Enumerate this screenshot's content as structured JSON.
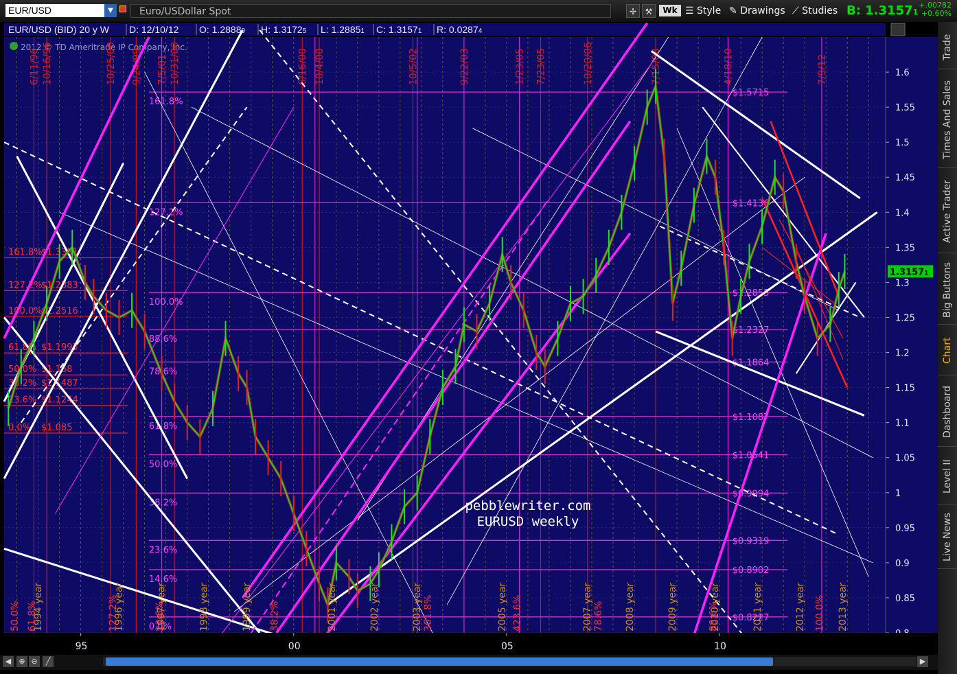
{
  "toolbar": {
    "symbol": "EUR/USD",
    "description": "Euro/USDollar Spot",
    "period_button": "Wk",
    "style_label": "Style",
    "drawings_label": "Drawings",
    "studies_label": "Studies",
    "bid_label": "B: 1.3157",
    "bid_suffix": "1",
    "change_abs": "+.00782",
    "change_pct": "+0.60%"
  },
  "sidebar": {
    "tabs": [
      "Trade",
      "Times And Sales",
      "Active Trader",
      "Big Buttons",
      "Chart",
      "Dashboard",
      "Level II",
      "Live News"
    ],
    "active": "Chart"
  },
  "chart_data": {
    "type": "line",
    "header": {
      "instrument": "EUR/USD (BID) 20 y W",
      "date": "D: 12/10/12",
      "open": "O: 1.2888",
      "open_s": "9",
      "high": "H: 1.3172",
      "high_s": "5",
      "low": "L: 1.2885",
      "low_s": "1",
      "close": "C: 1.3157",
      "close_s": "1",
      "range": "R: 0.0287",
      "range_s": "4",
      "copyright": "2012 © TD Ameritrade IP Company, Inc."
    },
    "ylim": [
      0.8,
      1.65
    ],
    "y_ticks": [
      0.8,
      0.85,
      0.9,
      0.95,
      1,
      1.05,
      1.1,
      1.15,
      1.2,
      1.25,
      1.3,
      1.35,
      1.4,
      1.45,
      1.5,
      1.55,
      1.6
    ],
    "y_tick_labels": [
      "0.8",
      "0.85",
      "0.9",
      "0.95",
      "1",
      "1.05",
      "1.1",
      "1.15",
      "1.2",
      "1.25",
      "1.3",
      "1.35",
      "1.4",
      "1.45",
      "1.5",
      "1.55",
      "1.6"
    ],
    "xlim": [
      1993.2,
      2013.9
    ],
    "x_ticks": [
      1995,
      2000,
      2005,
      2010
    ],
    "x_tick_labels": [
      "95",
      "00",
      "05",
      "10"
    ],
    "last_price": 1.3157,
    "last_price_label": "1.3157",
    "last_price_suffix": "1",
    "watermark": [
      "pebblewriter.com",
      "EURUSD weekly"
    ],
    "fib_right": [
      {
        "label": "161.8%",
        "price": "",
        "y": 1.5715
      },
      {
        "label": "127.2%",
        "price": "$1.4136",
        "y": 1.4136
      },
      {
        "label": "100.0%",
        "price": "$1.2855",
        "y": 1.2855
      },
      {
        "label": "88.6%",
        "price": "$1.2327",
        "y": 1.2327
      },
      {
        "label": "78.6%",
        "price": "$1.1864",
        "y": 1.1864
      },
      {
        "label": "61.8%",
        "price": "$1.1087",
        "y": 1.1087
      },
      {
        "label": "50.0%",
        "price": "$1.0541",
        "y": 1.0541
      },
      {
        "label": "38.2%",
        "price": "$0.9994",
        "y": 0.9994
      },
      {
        "label": "23.6%",
        "price": "$0.9319",
        "y": 0.9319
      },
      {
        "label": "14.6%",
        "price": "$0.8902",
        "y": 0.8902
      },
      {
        "label": "0.0%",
        "price": "$0.8227",
        "y": 0.8227
      }
    ],
    "fib_right_top_price": "$1.5715",
    "fib_left": [
      {
        "label": "161.8%",
        "price": "$1.3351",
        "y": 1.3351
      },
      {
        "label": "127.2%",
        "price": "$1.2883",
        "y": 1.2883
      },
      {
        "label": "100.0%",
        "price": "$1.2516",
        "y": 1.2516
      },
      {
        "label": "61.8%",
        "price": "$1.1993",
        "y": 1.1993
      },
      {
        "label": "50.0%",
        "price": "$1.168",
        "y": 1.168
      },
      {
        "label": "38.2%",
        "price": "$1.1487",
        "y": 1.1487
      },
      {
        "label": "23.6%",
        "price": "$1.1244",
        "y": 1.1244
      },
      {
        "label": "0.0%",
        "price": "$1.085",
        "y": 1.085
      }
    ],
    "date_labels": [
      {
        "text": "6/11/96",
        "x": 1993.9
      },
      {
        "text": "10/16/96",
        "x": 1994.2
      },
      {
        "text": "10/25/00",
        "x": 1995.7
      },
      {
        "text": "9/24/99",
        "x": 1996.3
      },
      {
        "text": "7/5/01",
        "x": 1996.9
      },
      {
        "text": "10/31/00",
        "x": 1997.2
      },
      {
        "text": "6/16/00",
        "x": 2000.2
      },
      {
        "text": "10/4/00",
        "x": 2000.6
      },
      {
        "text": "10/5/02",
        "x": 2002.8
      },
      {
        "text": "9/22/03",
        "x": 2004.0
      },
      {
        "text": "1/23/05",
        "x": 2005.3
      },
      {
        "text": "7/23/05",
        "x": 2005.8
      },
      {
        "text": "10/20/06",
        "x": 2006.9
      },
      {
        "text": "7/15/08",
        "x": 2008.5
      },
      {
        "text": "4/18/10",
        "x": 2010.2
      },
      {
        "text": "7/9/12",
        "x": 2012.4
      }
    ],
    "cycle_labels": [
      {
        "text": "1994 year",
        "x": 1994.1
      },
      {
        "text": "1996 year",
        "x": 1996.0
      },
      {
        "text": "1997 year",
        "x": 1997.0
      },
      {
        "text": "1998 year",
        "x": 1998.0
      },
      {
        "text": "1999 year",
        "x": 1999.0
      },
      {
        "text": "2001 year",
        "x": 2001.0
      },
      {
        "text": "2002 year",
        "x": 2002.0
      },
      {
        "text": "2003 year",
        "x": 2003.0
      },
      {
        "text": "2005 year",
        "x": 2005.0
      },
      {
        "text": "2007 year",
        "x": 2007.0
      },
      {
        "text": "2008 year",
        "x": 2008.0
      },
      {
        "text": "2009 year",
        "x": 2009.0
      },
      {
        "text": "2010 year",
        "x": 2010.0
      },
      {
        "text": "2011 year",
        "x": 2011.0
      },
      {
        "text": "2012 year",
        "x": 2012.0
      },
      {
        "text": "2013 year",
        "x": 2013.0
      }
    ],
    "time_fib_labels": [
      {
        "text": "50.0%",
        "x": 1993.3
      },
      {
        "text": "61.8%",
        "x": 1993.7
      },
      {
        "text": "127.2%",
        "x": 1995.6
      },
      {
        "text": "23.6%",
        "x": 1996.7
      },
      {
        "text": "38.2%",
        "x": 1999.4
      },
      {
        "text": "361.8%",
        "x": 2003.0
      },
      {
        "text": "423.6%",
        "x": 2005.1
      },
      {
        "text": "78.6%",
        "x": 2007.0
      },
      {
        "text": "88.6%",
        "x": 2009.7
      },
      {
        "text": "100.0%",
        "x": 2012.2
      }
    ],
    "series": [
      {
        "x": [
          1993.3,
          1993.6,
          1993.9,
          1994.2,
          1994.5,
          1994.8,
          1995.1,
          1995.3,
          1995.6,
          1995.9,
          1996.2,
          1996.5,
          1996.9,
          1997.2,
          1997.5,
          1997.8,
          1998.1,
          1998.4,
          1998.7,
          1998.9,
          1999.1,
          1999.4,
          1999.7,
          2000.0,
          2000.3,
          2000.6,
          2000.8,
          2001.0,
          2001.3,
          2001.5,
          2001.8,
          2002.0,
          2002.3,
          2002.6,
          2002.9,
          2003.2,
          2003.5,
          2003.8,
          2004.0,
          2004.3,
          2004.6,
          2004.9,
          2005.1,
          2005.4,
          2005.7,
          2005.9,
          2006.2,
          2006.5,
          2006.8,
          2007.1,
          2007.4,
          2007.7,
          2008.0,
          2008.3,
          2008.5,
          2008.7,
          2008.9,
          2009.1,
          2009.4,
          2009.7,
          2009.9,
          2010.1,
          2010.3,
          2010.5,
          2010.7,
          2011.0,
          2011.3,
          2011.5,
          2011.8,
          2012.0,
          2012.3,
          2012.6,
          2012.8,
          2012.94
        ],
        "values": [
          1.12,
          1.18,
          1.22,
          1.27,
          1.33,
          1.35,
          1.3,
          1.28,
          1.26,
          1.25,
          1.26,
          1.23,
          1.17,
          1.13,
          1.1,
          1.08,
          1.12,
          1.22,
          1.17,
          1.15,
          1.08,
          1.05,
          1.02,
          0.97,
          0.92,
          0.87,
          0.84,
          0.9,
          0.88,
          0.86,
          0.87,
          0.89,
          0.93,
          0.98,
          1.0,
          1.08,
          1.15,
          1.18,
          1.24,
          1.23,
          1.27,
          1.34,
          1.3,
          1.26,
          1.2,
          1.18,
          1.22,
          1.27,
          1.28,
          1.31,
          1.35,
          1.4,
          1.47,
          1.55,
          1.58,
          1.48,
          1.27,
          1.32,
          1.41,
          1.48,
          1.45,
          1.35,
          1.22,
          1.28,
          1.33,
          1.38,
          1.45,
          1.43,
          1.33,
          1.28,
          1.22,
          1.24,
          1.29,
          1.3157
        ]
      }
    ]
  }
}
